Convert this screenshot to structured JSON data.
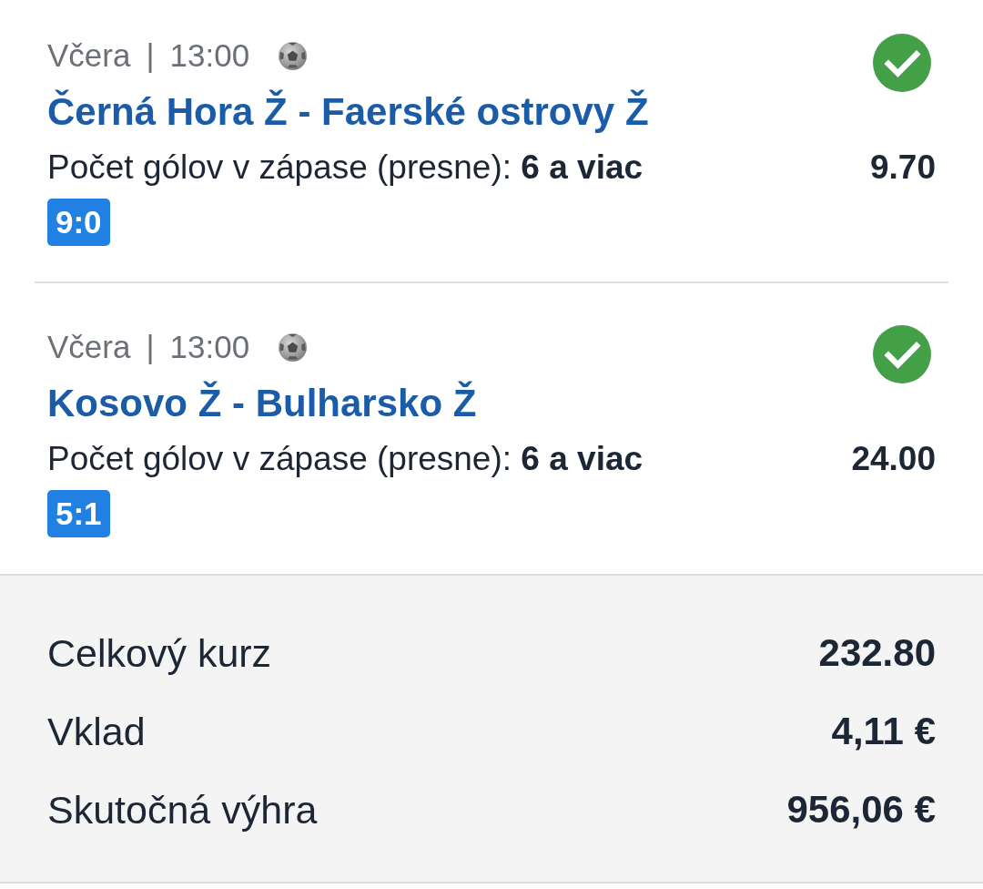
{
  "bets": [
    {
      "date": "Včera",
      "separator": "|",
      "time": "13:00",
      "won": true,
      "match": "Černá Hora Ž - Faerské ostrovy Ž",
      "market": "Počet gólov v zápase (presne): **6 a viac**",
      "odds": "9.70",
      "score": "9:0"
    },
    {
      "date": "Včera",
      "separator": "|",
      "time": "13:00",
      "won": true,
      "match": "Kosovo Ž - Bulharsko Ž",
      "market": "Počet gólov v zápase (presne): **6 a viac**",
      "odds": "24.00",
      "score": "5:1"
    }
  ],
  "summary": [
    {
      "label": "Celkový kurz",
      "value": "232.80"
    },
    {
      "label": "Vklad",
      "value": "4,11 €"
    },
    {
      "label": "Skutočná výhra",
      "value": "956,06 €"
    }
  ]
}
